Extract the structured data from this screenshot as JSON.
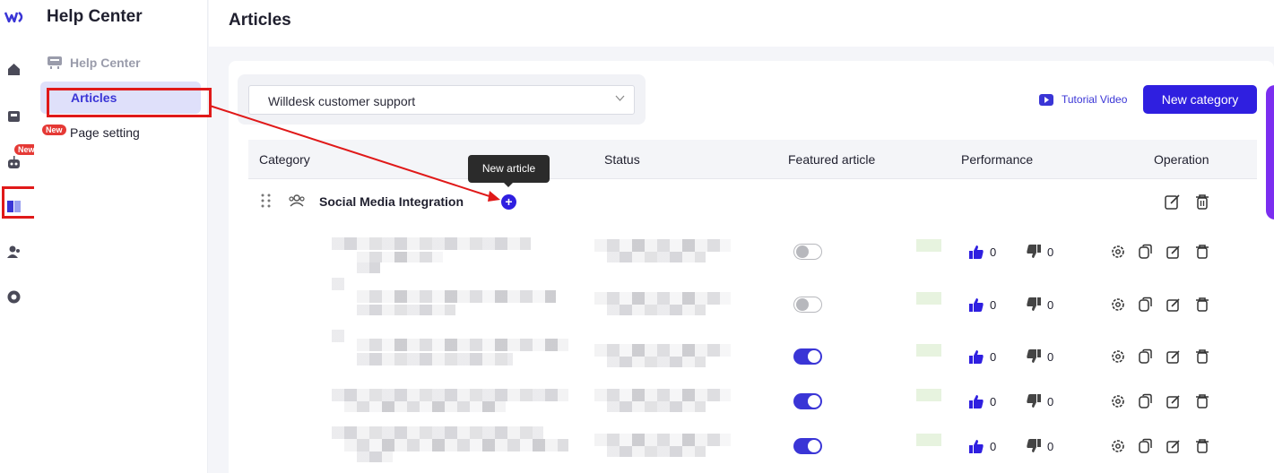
{
  "sidebar": {
    "title": "Help Center",
    "section_label": "Help Center",
    "items": [
      {
        "label": "Articles"
      },
      {
        "label": "Page setting",
        "badge": "New"
      }
    ]
  },
  "rail": {
    "logo": "WD",
    "new_badge": "New",
    "icons": [
      "home-icon",
      "inbox-icon",
      "bot-icon",
      "book-icon",
      "users-icon",
      "chart-icon"
    ]
  },
  "header": {
    "title": "Articles"
  },
  "toolbar": {
    "select_value": "Willdesk customer support",
    "tutorial_label": "Tutorial Video",
    "new_category_label": "New category"
  },
  "table": {
    "columns": [
      "Category",
      "Status",
      "Featured article",
      "Performance",
      "Operation"
    ],
    "category": {
      "name": "Social Media Integration"
    },
    "tooltip": "New article",
    "rows": [
      {
        "featured": false,
        "likes": "0",
        "dislikes": "0"
      },
      {
        "featured": false,
        "likes": "0",
        "dislikes": "0"
      },
      {
        "featured": true,
        "likes": "0",
        "dislikes": "0"
      },
      {
        "featured": true,
        "likes": "0",
        "dislikes": "0"
      },
      {
        "featured": true,
        "likes": "0",
        "dislikes": "0"
      }
    ]
  },
  "colors": {
    "accent": "#2f1fe0",
    "active_bg": "#dfe0fa",
    "annotation": "#e01919"
  }
}
